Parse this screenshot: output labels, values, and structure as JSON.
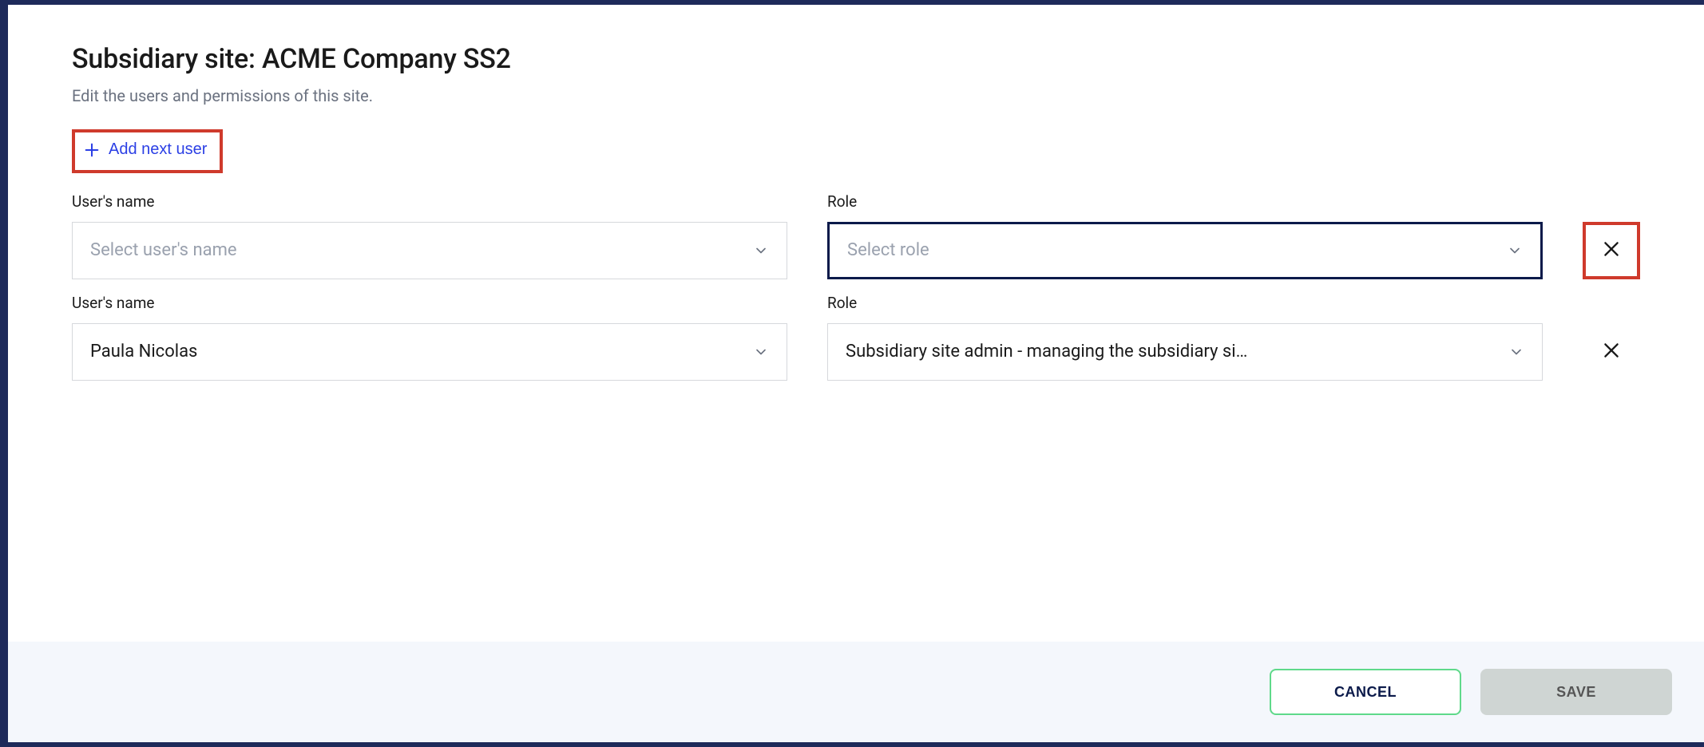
{
  "header": {
    "title": "Subsidiary site: ACME Company SS2",
    "subtitle": "Edit the users and permissions of this site."
  },
  "add_user_label": "Add next user",
  "fields": {
    "user_label": "User's name",
    "role_label": "Role",
    "user_placeholder": "Select user's name",
    "role_placeholder": "Select role"
  },
  "rows": [
    {
      "user": "",
      "role": "",
      "role_focused": true,
      "remove_highlight": true
    },
    {
      "user": "Paula Nicolas",
      "role": "Subsidiary site admin - managing the subsidiary si…",
      "role_focused": false,
      "remove_highlight": false
    }
  ],
  "footer": {
    "cancel": "CANCEL",
    "save": "SAVE"
  }
}
